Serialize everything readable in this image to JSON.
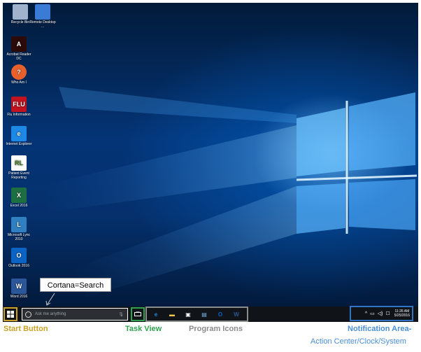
{
  "desktop_icons": [
    {
      "name": "recycle-bin",
      "label": "Recycle Bin",
      "color": "#9fb4cc"
    },
    {
      "name": "remote-desktop",
      "label": "Remote Desktop ...",
      "color": "#3a7bd5"
    },
    {
      "name": "acrobat-reader",
      "label": "Acrobat Reader DC",
      "color": "#2b0a0a"
    },
    {
      "name": "who-am-i",
      "label": "Who Am I",
      "color": "#e8602c"
    },
    {
      "name": "flu-information",
      "label": "Flu Information",
      "color": "#c1121f"
    },
    {
      "name": "internet-explorer",
      "label": "Internet Explorer",
      "color": "#1e88e5"
    },
    {
      "name": "patient-event-reporting",
      "label": "Patient Event Reporting",
      "color": "#ffffff"
    },
    {
      "name": "excel-2016",
      "label": "Excel 2016",
      "color": "#1d6f42"
    },
    {
      "name": "lync-2010",
      "label": "Microsoft Lync 2010",
      "color": "#2f7fc1"
    },
    {
      "name": "outlook-2016",
      "label": "Outlook 2016",
      "color": "#0b63c4"
    },
    {
      "name": "word-2016",
      "label": "Word 2016",
      "color": "#2b579a"
    }
  ],
  "icon_glyphs": {
    "acrobat-reader": "A",
    "flu-information": "FLU",
    "who-am-i": "?",
    "internet-explorer": "e",
    "patient-event-reporting": "RL",
    "excel-2016": "X",
    "lync-2010": "L",
    "outlook-2016": "O",
    "word-2016": "W"
  },
  "callout": {
    "text": "Cortana=Search"
  },
  "taskbar": {
    "search_placeholder": "Ask me anything",
    "programs": [
      {
        "name": "edge",
        "glyph": "e",
        "color": "#1e88e5"
      },
      {
        "name": "file-explorer",
        "glyph": "▬",
        "color": "#f2c94c"
      },
      {
        "name": "store",
        "glyph": "▣",
        "color": "#ffffff"
      },
      {
        "name": "notepad-app",
        "glyph": "▤",
        "color": "#7fb3e6"
      },
      {
        "name": "outlook",
        "glyph": "O",
        "color": "#0b63c4"
      },
      {
        "name": "word",
        "glyph": "W",
        "color": "#2b579a"
      }
    ],
    "clock_time": "11:26 AM",
    "clock_date": "5/25/2016"
  },
  "labels": {
    "start": "Start Button",
    "taskview": "Task View",
    "programs": "Program Icons",
    "notification": "Notification Area-",
    "notification_sub": "Action Center/Clock/System"
  }
}
